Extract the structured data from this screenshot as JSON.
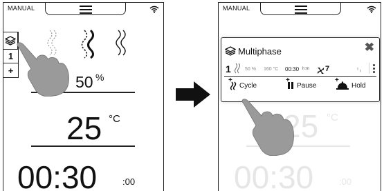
{
  "left_screen": {
    "mode_label": "MANUAL",
    "step_number": "1",
    "add_symbol": "+",
    "humidity_value": "50",
    "humidity_unit": "%",
    "temperature_value": "25",
    "temperature_unit": "°C",
    "time_value": "00:30",
    "time_seconds": ":00"
  },
  "right_screen": {
    "mode_label": "MANUAL",
    "dialog": {
      "title": "Multiphase",
      "close_symbol": "✖",
      "phase": {
        "number": "1",
        "humidity": "50 %",
        "temperature": "160 °C",
        "time": "00:30",
        "time_unit": "h:m",
        "fan_speed": "7"
      },
      "actions": [
        {
          "label": "Cycle",
          "plus": "+"
        },
        {
          "label": "Pause",
          "plus": "+"
        },
        {
          "label": "Hold",
          "plus": "+"
        }
      ]
    },
    "background_temperature": "25",
    "background_temperature_unit": "°C",
    "background_time": "00:30",
    "background_time_seconds": ":00"
  },
  "colors": {
    "ink": "#111111",
    "dimmed": "#e6e6e6",
    "hand": "#9a9a9a",
    "arrow": "#111111"
  }
}
